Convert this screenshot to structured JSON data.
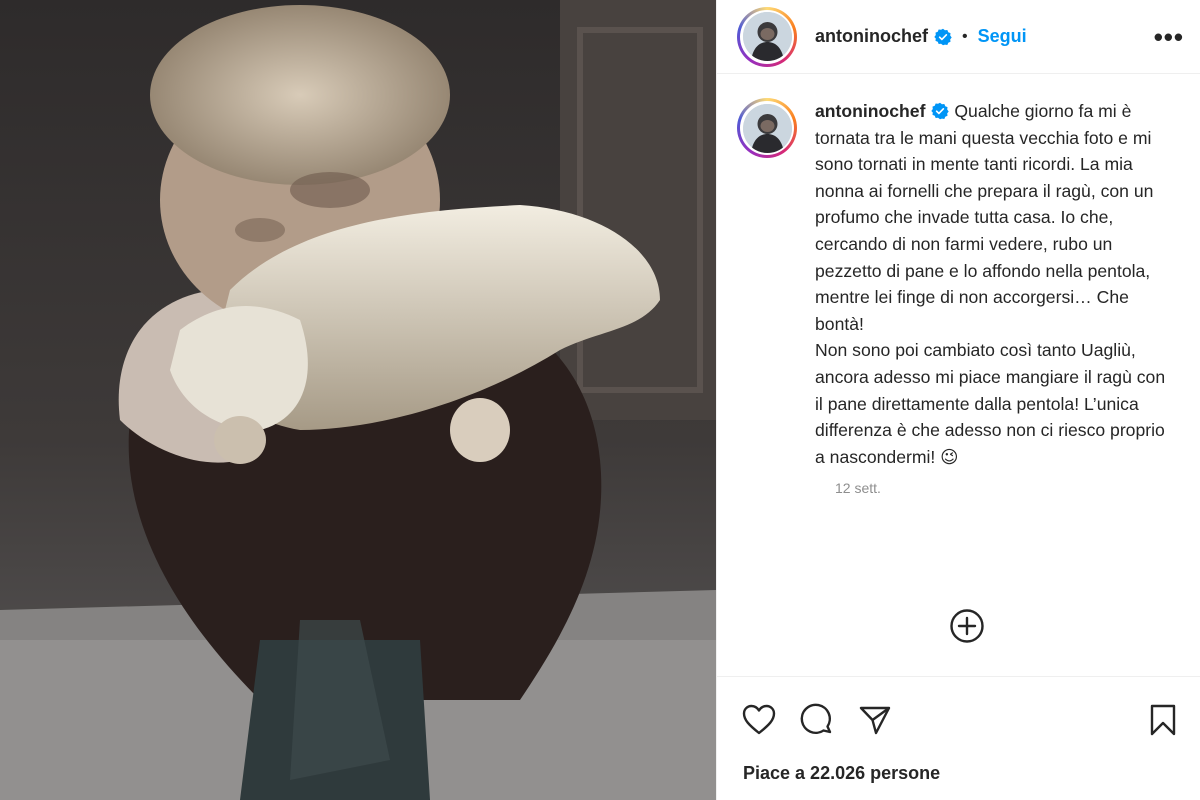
{
  "post": {
    "username": "antoninochef",
    "follow_label": "Segui",
    "separator": "•",
    "more_label": "•••"
  },
  "caption": {
    "username": "antoninochef",
    "text": "Qualche giorno fa mi è tornata tra le mani questa vecchia foto e mi sono tornati in mente tanti ricordi. La mia nonna ai fornelli che prepara il ragù, con un profumo che invade tutta casa. Io che, cercando di non farmi vedere, rubo un pezzetto di pane e lo affondo nella pentola, mentre lei finge di non accorgersi… Che bontà!\nNon sono poi cambiato così tanto Uagliù, ancora adesso mi piace mangiare il ragù con il pane direttamente dalla pentola! L’unica differenza è che adesso non ci riesco proprio a nascondermi! 😉",
    "time": "12 sett."
  },
  "likes": {
    "text": "Piace a 22.026 persone"
  },
  "icons": {
    "verified": "verified-badge-icon",
    "load_more": "plus-circle-icon",
    "like": "heart-icon",
    "comment": "comment-icon",
    "share": "paper-plane-icon",
    "save": "bookmark-icon"
  },
  "colors": {
    "accent": "#0095f6",
    "text": "#262626",
    "muted": "#8e8e8e"
  }
}
